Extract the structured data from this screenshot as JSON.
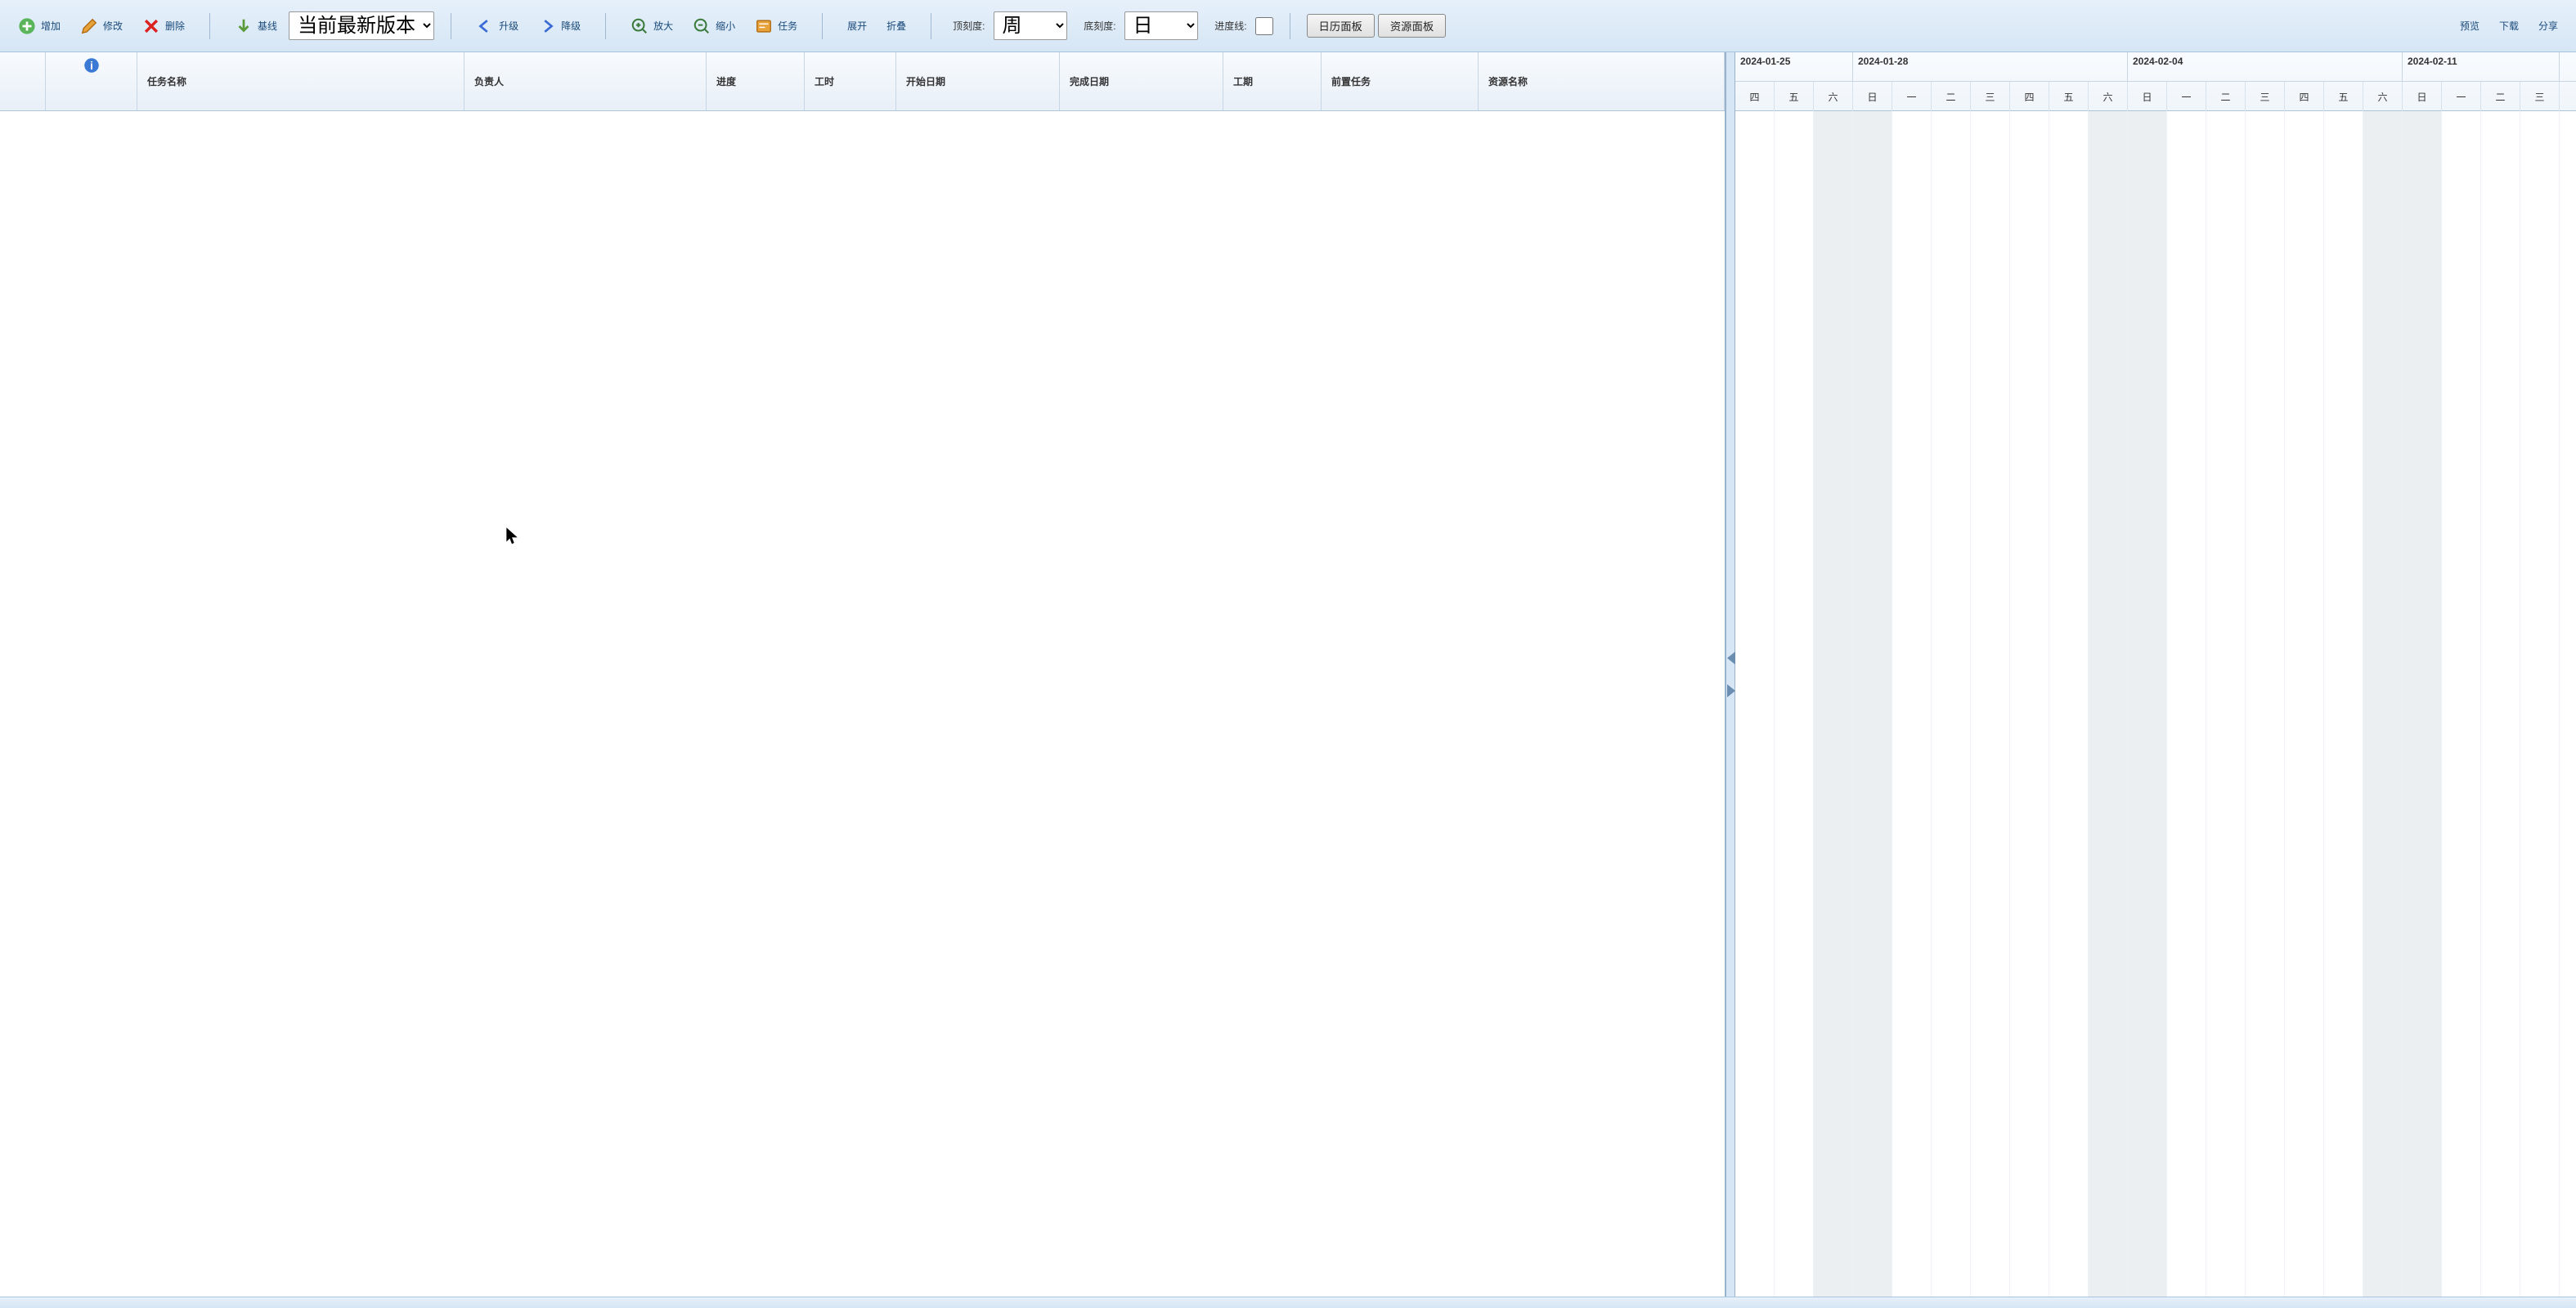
{
  "toolbar": {
    "add": "增加",
    "edit": "修改",
    "delete": "删除",
    "baseline": "基线",
    "version_options": [
      "当前最新版本"
    ],
    "version_selected": "当前最新版本",
    "upgrade": "升级",
    "downgrade": "降级",
    "zoom_in": "放大",
    "zoom_out": "缩小",
    "task": "任务",
    "expand": "展开",
    "collapse": "折叠",
    "top_scale_label": "顶刻度:",
    "top_scale_options": [
      "周"
    ],
    "top_scale_selected": "周",
    "bottom_scale_label": "底刻度:",
    "bottom_scale_options": [
      "日"
    ],
    "bottom_scale_selected": "日",
    "progress_line_label": "进度线:",
    "calendar_panel": "日历面板",
    "resource_panel": "资源面板",
    "preview": "预览",
    "download": "下载",
    "share": "分享"
  },
  "grid": {
    "columns": {
      "row": "",
      "info": "",
      "name": "任务名称",
      "owner": "负责人",
      "progress": "进度",
      "hours": "工时",
      "start": "开始日期",
      "end": "完成日期",
      "duration": "工期",
      "predecessor": "前置任务",
      "resource": "资源名称"
    }
  },
  "timeline": {
    "weeks": [
      {
        "label": "2024-01-25",
        "days": [
          "四",
          "五",
          "六"
        ]
      },
      {
        "label": "2024-01-28",
        "days": [
          "日",
          "一",
          "二",
          "三",
          "四",
          "五",
          "六"
        ]
      },
      {
        "label": "2024-02-04",
        "days": [
          "日",
          "一",
          "二",
          "三",
          "四",
          "五",
          "六"
        ]
      },
      {
        "label": "2024-02-11",
        "days": [
          "日",
          "一",
          "二",
          "三"
        ]
      }
    ],
    "weekend_indices": [
      2,
      3,
      9,
      10,
      16,
      17
    ]
  }
}
